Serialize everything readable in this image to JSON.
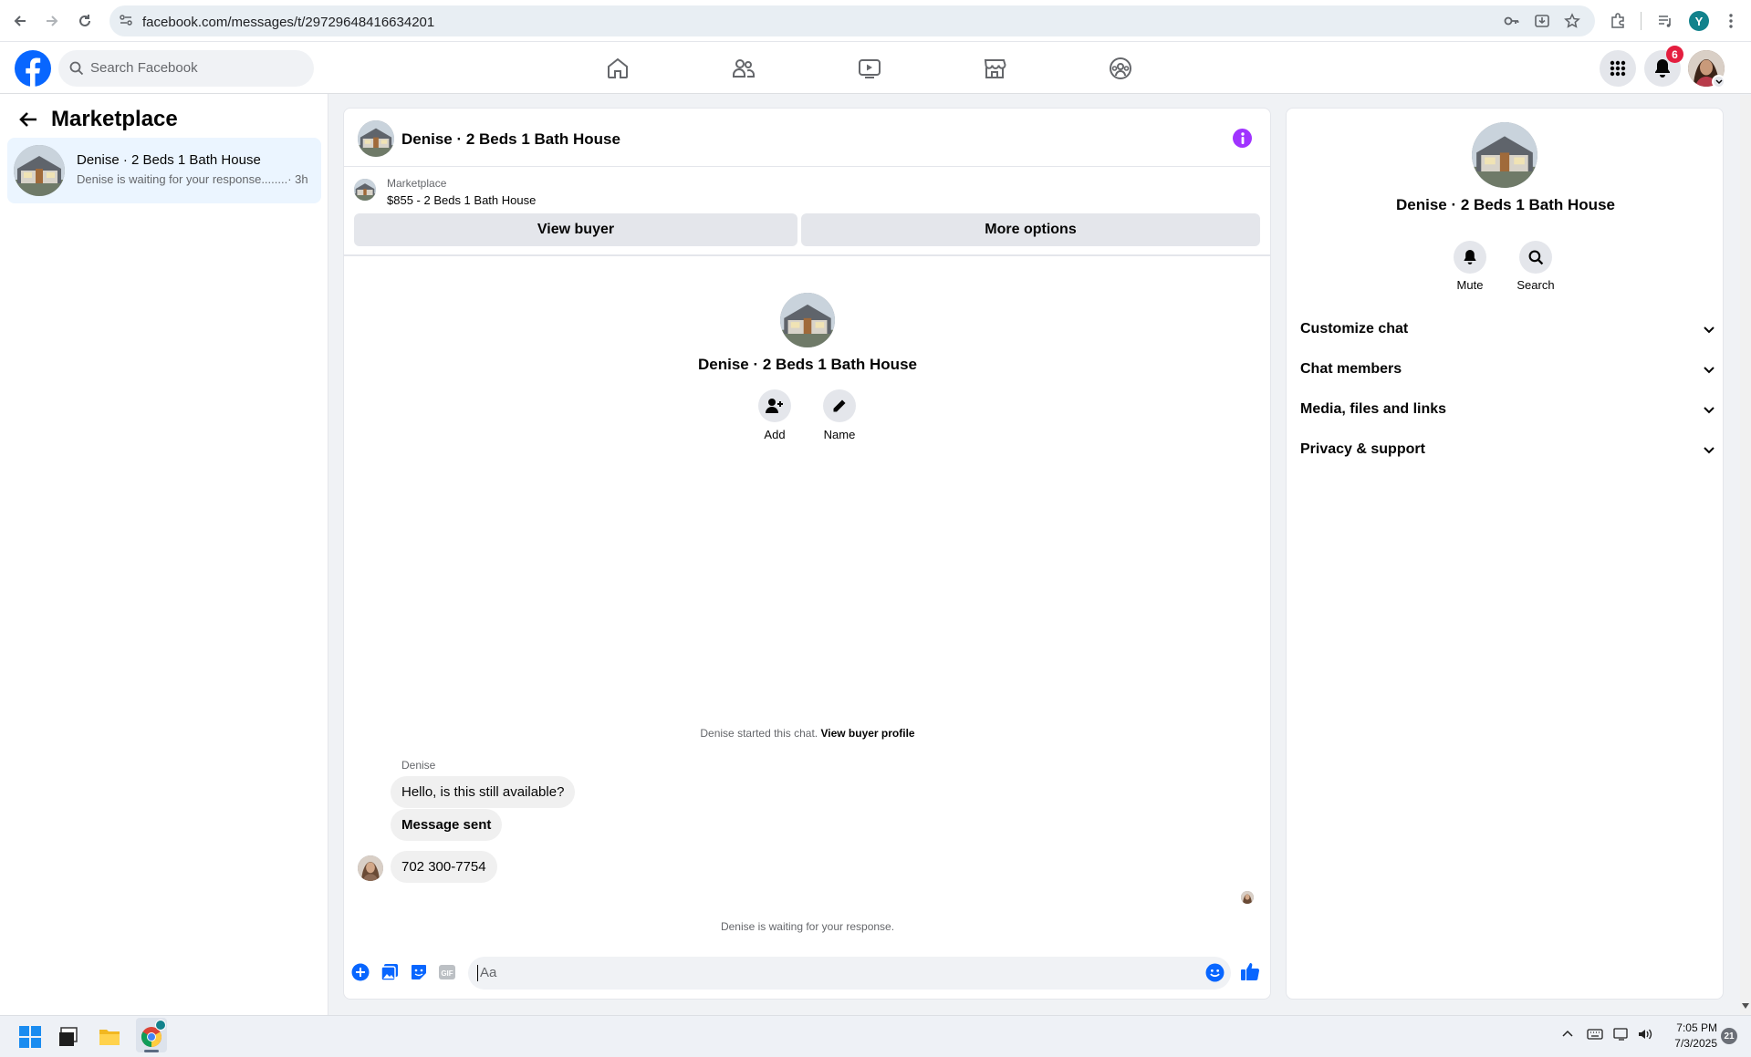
{
  "browser": {
    "url": "facebook.com/messages/t/29729648416634201",
    "profile_initial": "Y"
  },
  "facebook": {
    "search_placeholder": "Search Facebook",
    "notification_count": "6"
  },
  "left_panel": {
    "title": "Marketplace",
    "conversation": {
      "name": "Denise · 2 Beds 1 Bath House",
      "preview": "Denise is waiting for your response........",
      "time": "· 3h"
    }
  },
  "chat": {
    "header_title": "Denise · 2 Beds 1 Bath House",
    "listing": {
      "source": "Marketplace",
      "title": "$855 - 2 Beds 1 Bath House"
    },
    "view_buyer_label": "View buyer",
    "more_options_label": "More options",
    "intro": {
      "name": "Denise · 2 Beds 1 Bath House",
      "add_label": "Add",
      "name_label": "Name"
    },
    "started_text": "Denise started this chat.",
    "view_buyer_profile": "View buyer profile",
    "sender_name": "Denise",
    "messages": [
      {
        "text": "Hello, is this still available?",
        "bold": false
      },
      {
        "text": "Message sent",
        "bold": true
      },
      {
        "text": "702 300-7754",
        "bold": false
      }
    ],
    "waiting_text": "Denise is waiting for your response.",
    "composer_placeholder": "Aa"
  },
  "info_panel": {
    "name": "Denise · 2 Beds 1 Bath House",
    "mute_label": "Mute",
    "search_label": "Search",
    "sections": [
      "Customize chat",
      "Chat members",
      "Media, files and links",
      "Privacy & support"
    ]
  },
  "taskbar": {
    "time": "7:05 PM",
    "date": "7/3/2025",
    "notification_count": "21"
  },
  "colors": {
    "facebook_blue": "#0866ff",
    "messenger_purple": "#a033ff",
    "notification_red": "#e41e3f"
  }
}
